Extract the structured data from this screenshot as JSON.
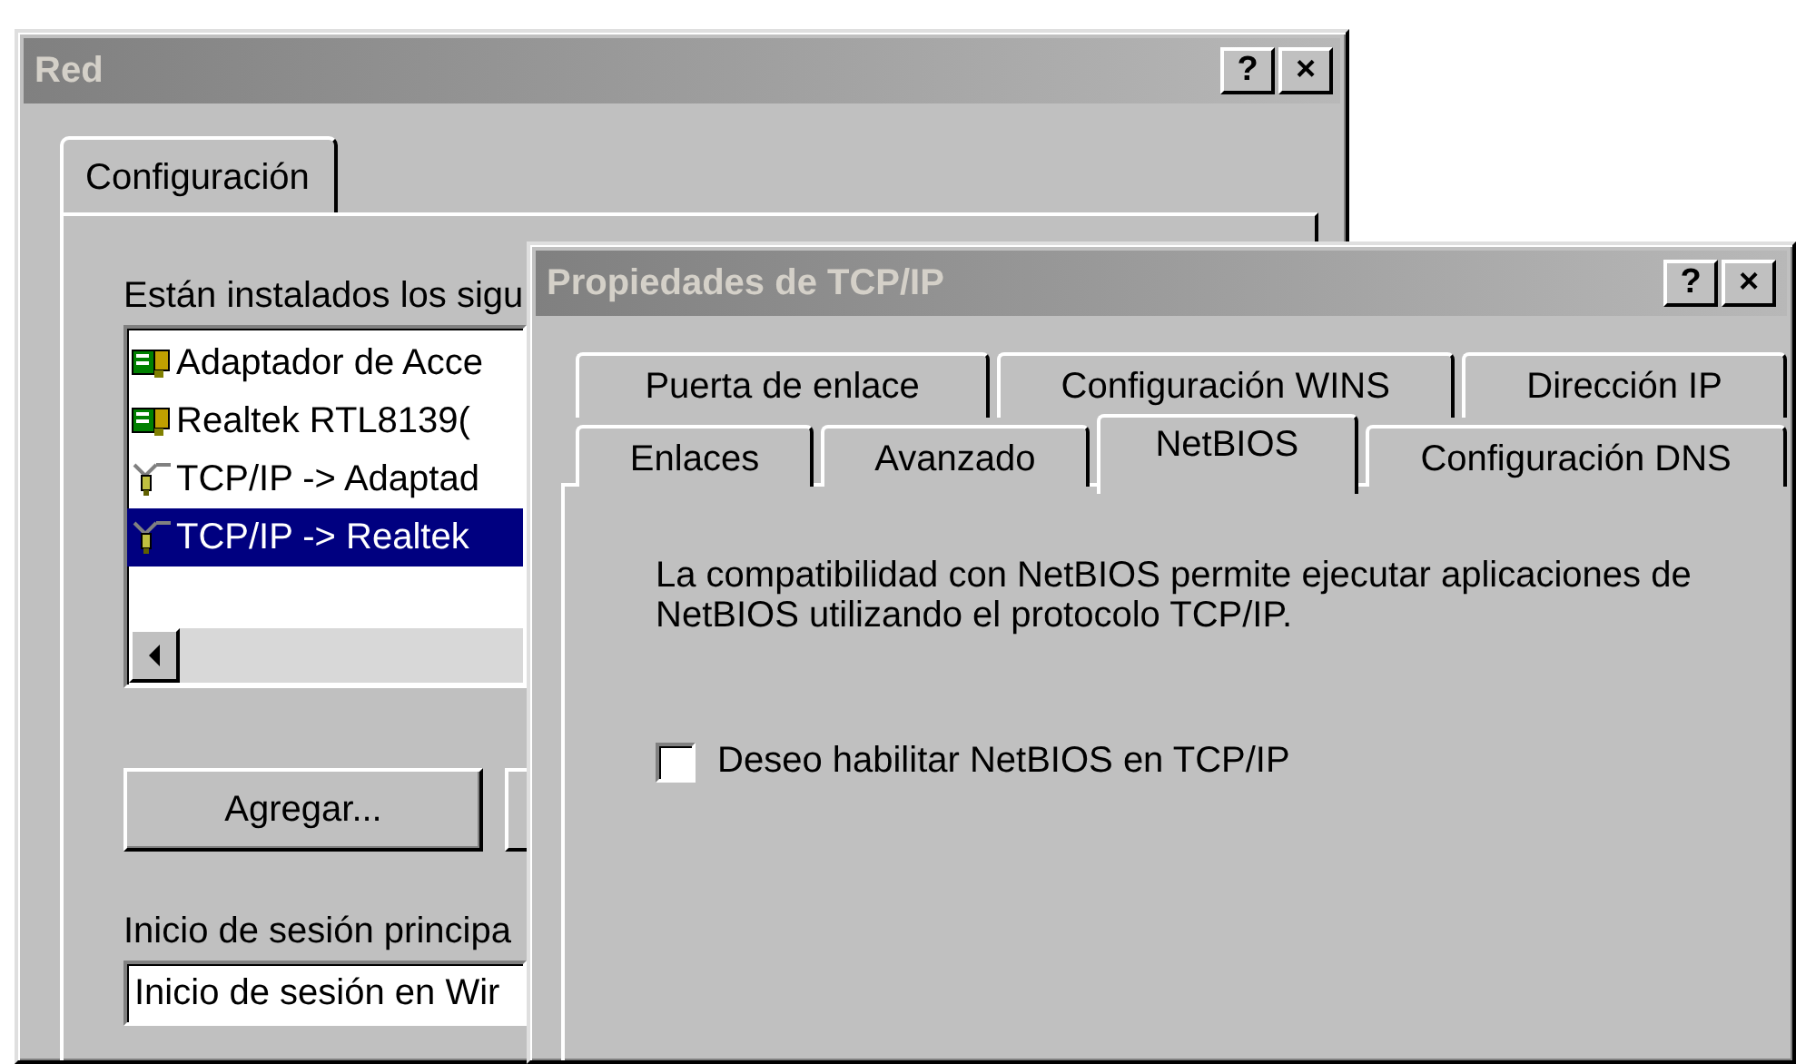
{
  "network_window": {
    "title": "Red",
    "title_buttons": [
      "?",
      "×"
    ],
    "tabs": [
      {
        "label": "Configuración",
        "selected": true
      }
    ],
    "components_label": "Están instalados los sigu",
    "components": [
      {
        "kind": "adapter",
        "label": "Adaptador de Acce",
        "selected": false
      },
      {
        "kind": "adapter",
        "label": "Realtek RTL8139(",
        "selected": false
      },
      {
        "kind": "protocol",
        "label": "TCP/IP -> Adaptad",
        "selected": false
      },
      {
        "kind": "protocol",
        "label": "TCP/IP -> Realtek",
        "selected": true
      }
    ],
    "add_button": "Agregar...",
    "logon_label": "Inicio de sesión principa",
    "logon_value": "Inicio de sesión en Wir"
  },
  "tcpip_window": {
    "title": "Propiedades de TCP/IP",
    "title_buttons": [
      "?",
      "×"
    ],
    "tab_rows": [
      [
        {
          "label": "Puerta de enlace",
          "selected": false
        },
        {
          "label": "Configuración WINS",
          "selected": false
        },
        {
          "label": "Dirección IP",
          "selected": false
        }
      ],
      [
        {
          "label": "Enlaces",
          "selected": false
        },
        {
          "label": "Avanzado",
          "selected": false
        },
        {
          "label": "NetBIOS",
          "selected": true
        },
        {
          "label": "Configuración DNS",
          "selected": false
        }
      ]
    ],
    "description": "La compatibilidad con NetBIOS permite ejecutar aplicaciones de NetBIOS utilizando el protocolo TCP/IP.",
    "checkbox": {
      "label": "Deseo habilitar NetBIOS en TCP/IP",
      "checked": false
    }
  }
}
